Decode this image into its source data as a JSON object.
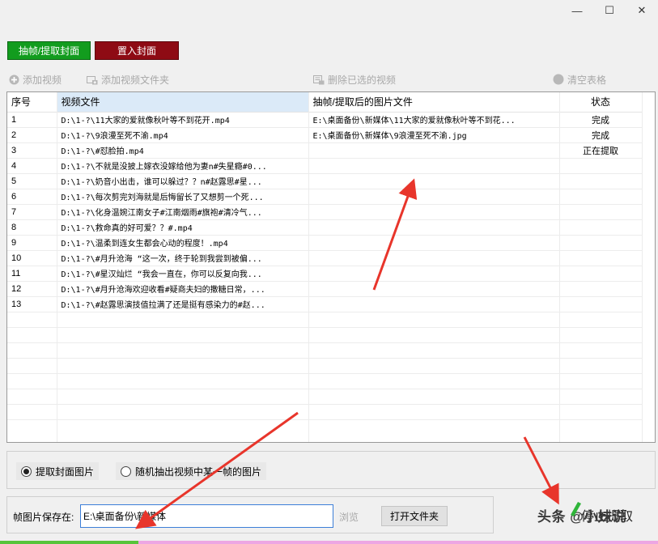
{
  "window_controls": {
    "minimize": "—",
    "maximize": "☐",
    "close": "✕"
  },
  "actions": {
    "extract_label": "抽帧/提取封面",
    "insert_label": "置入封面"
  },
  "toolbar": {
    "add_video": "添加视频",
    "add_folder": "添加视频文件夹",
    "delete_selected": "删除已选的视频",
    "clear_table": "清空表格"
  },
  "table": {
    "headers": [
      "序号",
      "视频文件",
      "抽帧/提取后的图片文件",
      "状态"
    ],
    "rows": [
      [
        "1",
        "D:\\1-?\\11大家的爱就像秋叶等不到花开.mp4",
        "E:\\桌面备份\\新媒体\\11大家的爱就像秋叶等不到花...",
        "完成"
      ],
      [
        "2",
        "D:\\1-?\\9浪漫至死不渝.mp4",
        "E:\\桌面备份\\新媒体\\9浪漫至死不渝.jpg",
        "完成"
      ],
      [
        "3",
        "D:\\1-?\\#怼脸拍.mp4",
        "",
        "正在提取"
      ],
      [
        "4",
        "D:\\1-?\\不就是没披上嫁衣没嫁给他为妻n#失星瘾#0...",
        "",
        ""
      ],
      [
        "5",
        "D:\\1-?\\奶音小出击，谁可以躲过？？n#赵露思#星...",
        "",
        ""
      ],
      [
        "6",
        "D:\\1-?\\每次剪完刘海就是后悔留长了又想剪一个死...",
        "",
        ""
      ],
      [
        "7",
        "D:\\1-?\\化身温婉江南女子#江南烟雨#旗袍#清冷气...",
        "",
        ""
      ],
      [
        "8",
        "D:\\1-?\\救命真的好可爱？？#.mp4",
        "",
        ""
      ],
      [
        "9",
        "D:\\1-?\\温柔到连女生都会心动的程度！.mp4",
        "",
        ""
      ],
      [
        "10",
        "D:\\1-?\\#月升沧海 “这一次，终于轮到我尝到被偏...",
        "",
        ""
      ],
      [
        "11",
        "D:\\1-?\\#星汉灿烂 “我会一直在，你可以反复向我...",
        "",
        ""
      ],
      [
        "12",
        "D:\\1-?\\#月升沧海欢迎收看#疑商夫妇的撒糖日常，...",
        "",
        ""
      ],
      [
        "13",
        "D:\\1-?\\#赵露思演技值拉满了还是挺有感染力的#赵...",
        "",
        ""
      ]
    ]
  },
  "options": {
    "extract_cover_label": "提取封面图片",
    "extract_cover_selected": true,
    "random_frame_label": "随机抽出视频中某一帧的图片",
    "random_frame_selected": false
  },
  "save": {
    "label": "帧图片保存在:",
    "path": "E:\\桌面备份\\新媒体",
    "browse_label": "浏览",
    "open_folder_label": "打开文件夹"
  },
  "start_label": "停止提取",
  "watermark": "头条 @小妹说",
  "progress": 0.21,
  "colors": {
    "extract_btn": "#129c1e",
    "insert_btn": "#8e0b14",
    "header_selected": "#dbeaf8",
    "annotation_arrow": "#e8352b"
  }
}
